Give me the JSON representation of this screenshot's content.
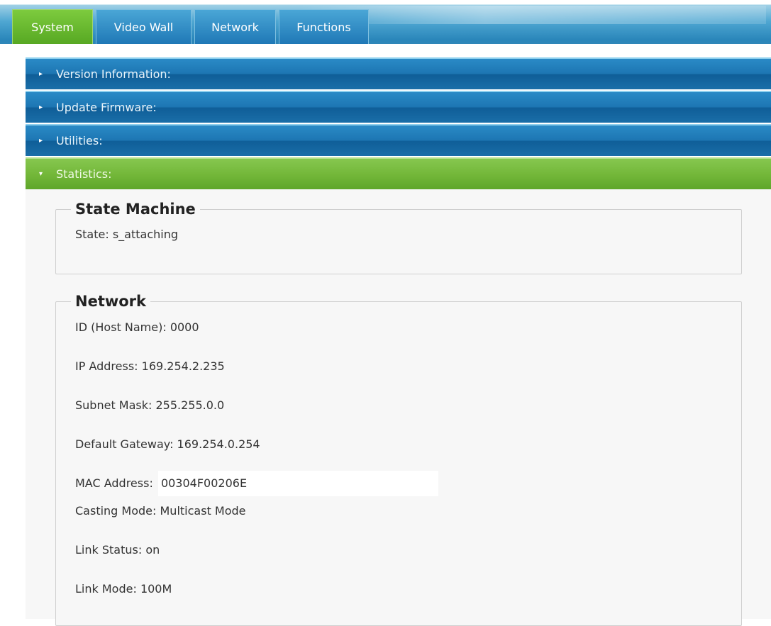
{
  "tabs": [
    {
      "label": "System",
      "active": true
    },
    {
      "label": "Video Wall",
      "active": false
    },
    {
      "label": "Network",
      "active": false
    },
    {
      "label": "Functions",
      "active": false
    }
  ],
  "sections": [
    {
      "label": "Version Information:",
      "expanded": false
    },
    {
      "label": "Update Firmware:",
      "expanded": false
    },
    {
      "label": "Utilities:",
      "expanded": false
    },
    {
      "label": "Statistics:",
      "expanded": true
    }
  ],
  "state_machine": {
    "title": "State Machine",
    "state_label": "State:",
    "state_value": "s_attaching"
  },
  "network": {
    "title": "Network",
    "rows": [
      {
        "label": "ID (Host Name):",
        "value": "0000"
      },
      {
        "label": "IP Address:",
        "value": "169.254.2.235"
      },
      {
        "label": "Subnet Mask:",
        "value": "255.255.0.0"
      },
      {
        "label": "Default Gateway:",
        "value": "169.254.0.254"
      },
      {
        "label": "MAC Address:",
        "value": "00304F00206E"
      },
      {
        "label": "Casting Mode:",
        "value": "Multicast Mode"
      },
      {
        "label": "Link Status:",
        "value": "on"
      },
      {
        "label": "Link Mode:",
        "value": "100M"
      }
    ]
  },
  "colors": {
    "tab_blue": "#1f78b6",
    "tab_green": "#6cbb35",
    "section_blue": "#1d76b3",
    "section_green": "#74b83a",
    "content_bg": "#f7f7f7"
  }
}
